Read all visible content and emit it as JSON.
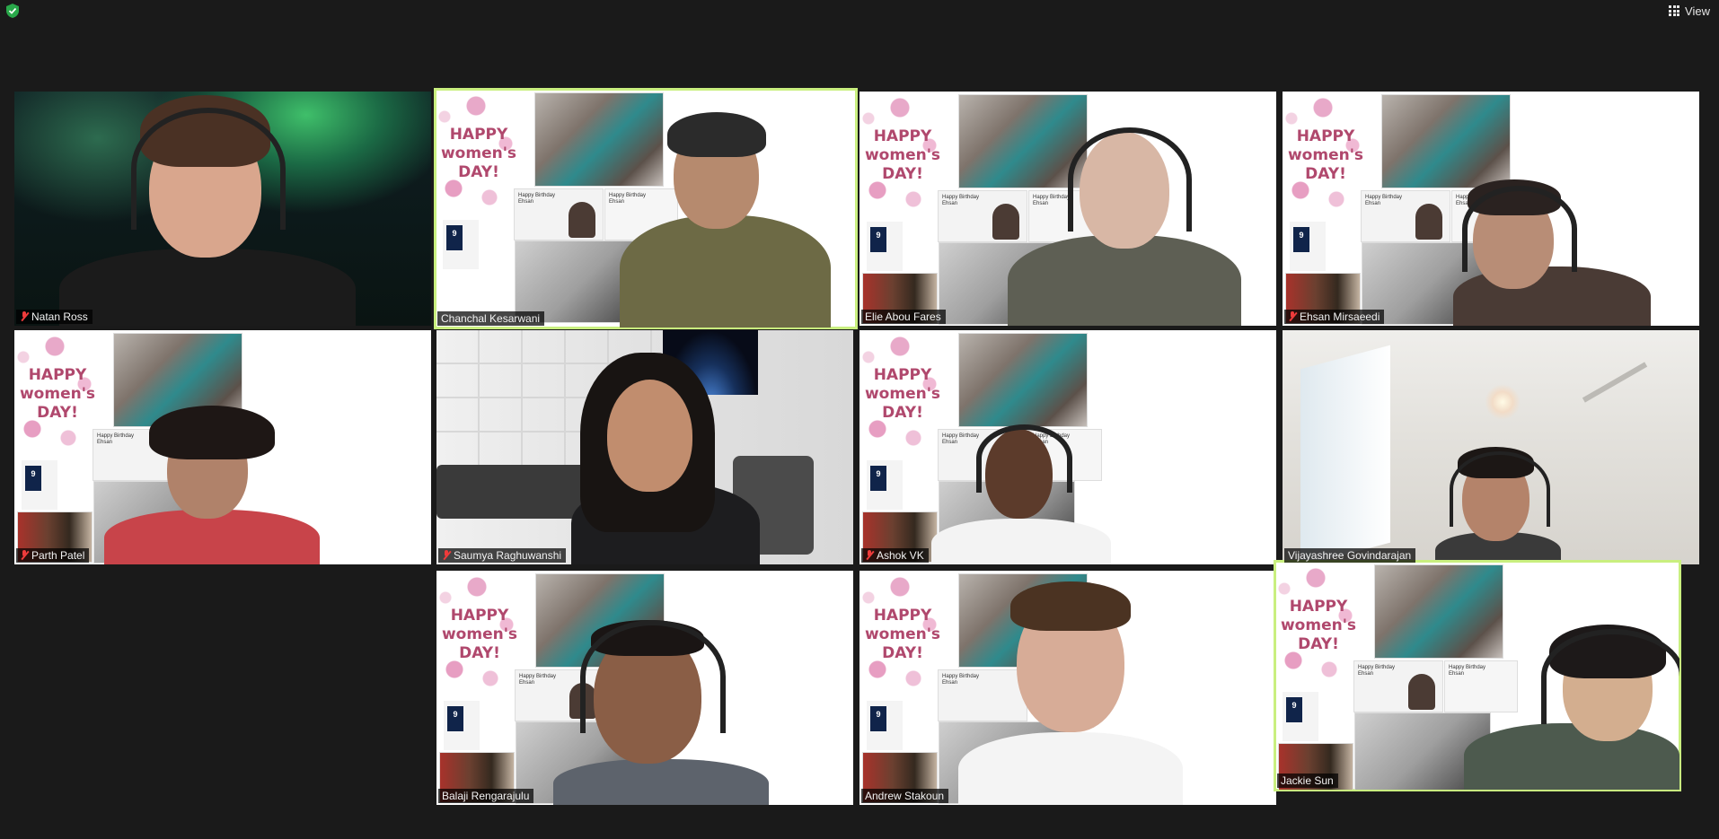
{
  "toolbar": {
    "view_label": "View",
    "security_icon": "shield-check-icon",
    "view_icon": "grid-icon"
  },
  "virtual_background": {
    "headline_line1": "HAPPY",
    "headline_line2": "women's",
    "headline_line3": "DAY!",
    "card_text": "Happy Birthday",
    "card_text2": "Ehsan",
    "phone_number": "9"
  },
  "participants": [
    {
      "name": "Natan Ross",
      "muted": true,
      "active": false
    },
    {
      "name": "Chanchal Kesarwani",
      "muted": false,
      "active": true
    },
    {
      "name": "Elie Abou Fares",
      "muted": false,
      "active": false
    },
    {
      "name": "Ehsan Mirsaeedi",
      "muted": true,
      "active": false
    },
    {
      "name": "Parth Patel",
      "muted": true,
      "active": false
    },
    {
      "name": "Saumya Raghuwanshi",
      "muted": true,
      "active": false
    },
    {
      "name": "Ashok VK",
      "muted": true,
      "active": false
    },
    {
      "name": "Vijayashree Govindarajan",
      "muted": false,
      "active": false
    },
    {
      "name": "Balaji Rengarajulu",
      "muted": false,
      "active": false
    },
    {
      "name": "Andrew Stakoun",
      "muted": false,
      "active": false
    },
    {
      "name": "Jackie Sun",
      "muted": false,
      "active": true
    }
  ],
  "colors": {
    "background": "#1a1a1a",
    "active_speaker": "#c9ef7f",
    "muted_mic": "#ee3b3b",
    "headline": "#b0486d"
  }
}
